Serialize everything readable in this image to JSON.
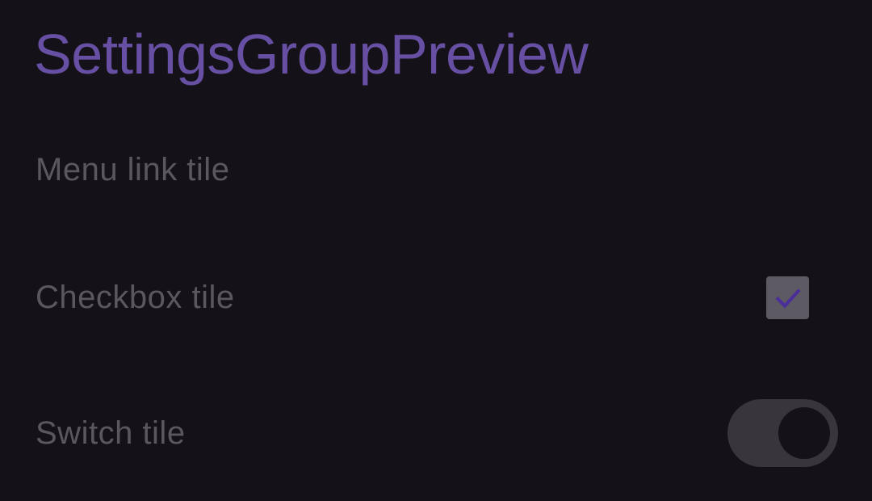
{
  "settings_group": {
    "title": "SettingsGroupPreview",
    "tiles": [
      {
        "label": "Menu link tile"
      },
      {
        "label": "Checkbox tile",
        "checked": true
      },
      {
        "label": "Switch tile",
        "switch_on": true
      }
    ]
  },
  "colors": {
    "background": "#141218",
    "title": "#6750A4",
    "label": "#5a575e",
    "checkbox_fill": "#5d5a63",
    "checkmark": "#4a2e9a",
    "switch_track": "#38363c",
    "switch_thumb": "#141218"
  },
  "icons": {
    "checkbox": "checkmark-icon"
  }
}
